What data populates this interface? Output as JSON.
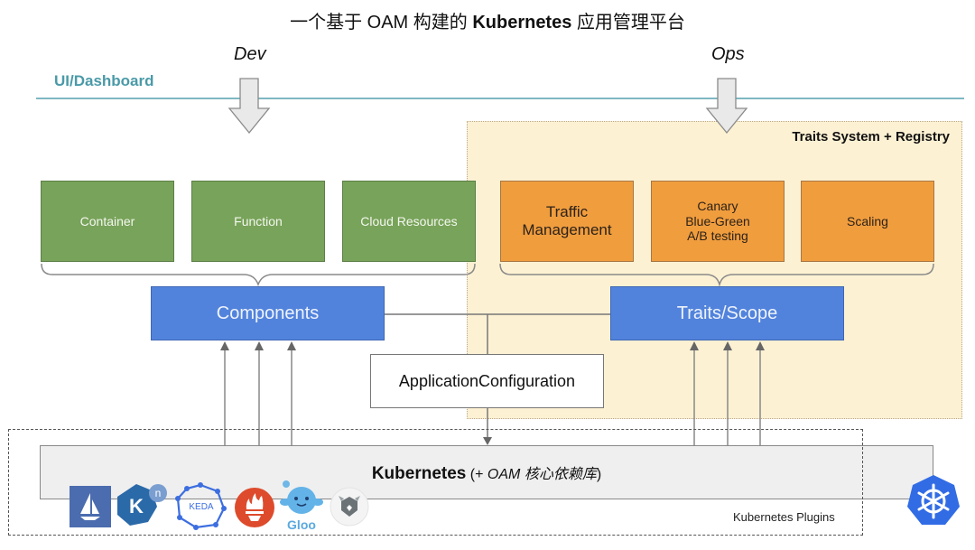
{
  "title": {
    "prefix": "一个基于 OAM 构建的 ",
    "bold": "Kubernetes",
    "suffix": " 应用管理平台"
  },
  "roles": {
    "dev": "Dev",
    "ops": "Ops"
  },
  "dashboard_label": "UI/Dashboard",
  "traits_system_label": "Traits System + Registry",
  "components_sources": [
    {
      "label": "Container"
    },
    {
      "label": "Function"
    },
    {
      "label": "Cloud Resources"
    }
  ],
  "traits_list": [
    {
      "lines": [
        "Traffic",
        "Management"
      ]
    },
    {
      "lines": [
        "Canary",
        "Blue-Green",
        "A/B testing"
      ]
    },
    {
      "lines": [
        "Scaling"
      ]
    }
  ],
  "components_label": "Components",
  "traits_scope_label": "Traits/Scope",
  "app_config_label": "ApplicationConfiguration",
  "kubernetes": {
    "bold": "Kubernetes",
    "suffix_plain": " (+ ",
    "suffix_italic": "OAM 核心依赖库",
    "suffix_close": ")"
  },
  "plugins_label": "Kubernetes Plugins",
  "plugin_logos": [
    {
      "name": "istio",
      "icon": "sailboat-icon"
    },
    {
      "name": "knative",
      "icon": "knative-icon",
      "text": "K",
      "sup": "n"
    },
    {
      "name": "keda",
      "icon": "keda-icon",
      "text": "KEDA"
    },
    {
      "name": "prometheus",
      "icon": "prometheus-icon"
    },
    {
      "name": "gloo",
      "icon": "gloo-icon",
      "text": "Gloo"
    },
    {
      "name": "opa",
      "icon": "opa-icon"
    }
  ],
  "colors": {
    "component_green": "#78a35a",
    "trait_orange": "#f09d3e",
    "core_blue": "#5283dc",
    "traits_area": "#fdf1d3",
    "dashboard_teal": "#4a9aa8",
    "k8s_blue": "#326ce5"
  }
}
